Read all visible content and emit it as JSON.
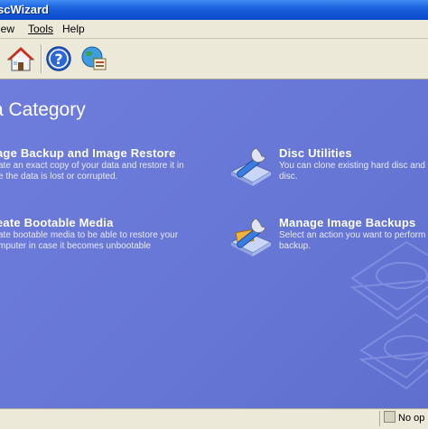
{
  "window": {
    "title": "scWizard"
  },
  "menu": {
    "view": "iew",
    "tools": "Tools",
    "help": "Help"
  },
  "toolbar": {
    "icons": [
      "home-icon",
      "help-icon",
      "web-icon"
    ]
  },
  "main": {
    "heading": "a Category",
    "categories": [
      {
        "title": "age Backup and Image Restore",
        "desc": [
          "ate an exact copy of your data and restore it in",
          "e the data is lost or corrupted."
        ]
      },
      {
        "title": "Disc Utilities",
        "desc": [
          "You can clone existing hard disc and",
          "disc."
        ]
      },
      {
        "title": "eate Bootable Media",
        "desc": [
          "ate bootable media to be able to restore your",
          "mputer in case it becomes unbootable"
        ]
      },
      {
        "title": "Manage Image Backups",
        "desc": [
          "Select an action you want to perform",
          "backup."
        ]
      }
    ]
  },
  "status": {
    "text": "No op"
  },
  "colors": {
    "background": "#6a79d6",
    "titlebar": "#1a5fdc",
    "chrome": "#ece9d8"
  }
}
